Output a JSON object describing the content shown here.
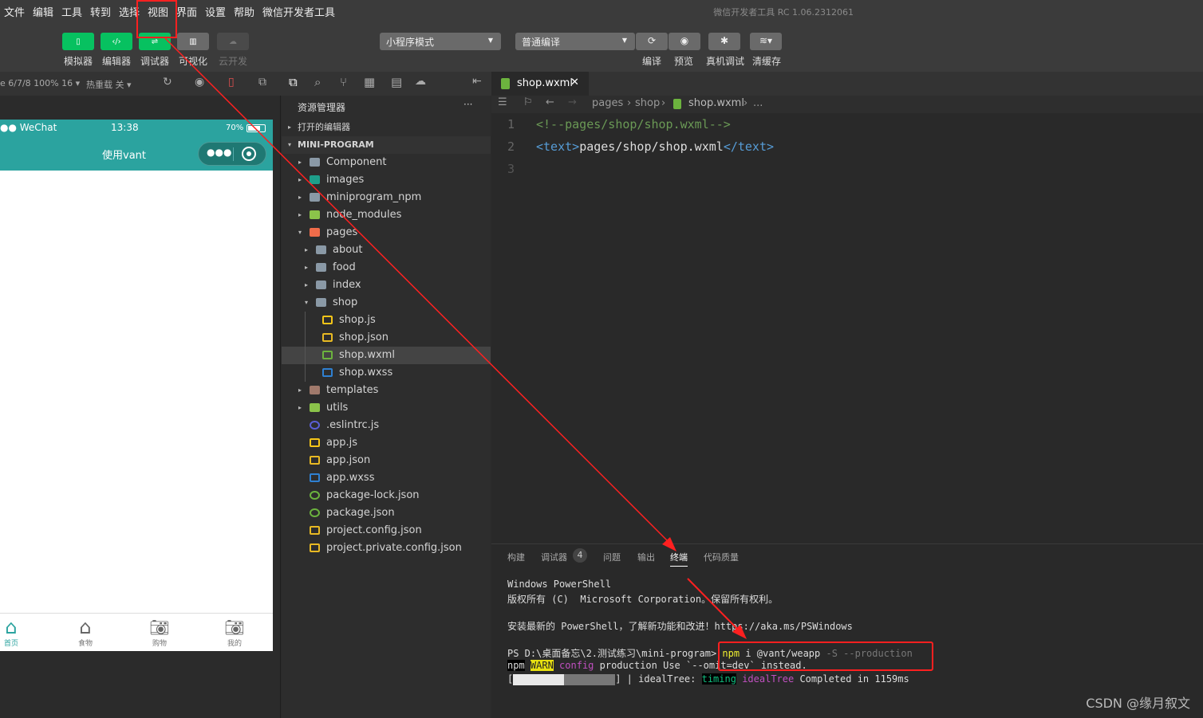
{
  "menu": [
    "文件",
    "编辑",
    "工具",
    "转到",
    "选择",
    "视图",
    "界面",
    "设置",
    "帮助",
    "微信开发者工具"
  ],
  "window_title": "微信开发者工具 RC 1.06.2312061",
  "toolbar": {
    "buttons": [
      {
        "label": "模拟器",
        "icon": "phone-icon"
      },
      {
        "label": "编辑器",
        "icon": "code-icon"
      },
      {
        "label": "调试器",
        "icon": "sliders-icon"
      },
      {
        "label": "可视化",
        "icon": "layout-icon"
      },
      {
        "label": "云开发",
        "icon": "cloud-icon"
      }
    ],
    "mode_select": "小程序模式",
    "compile_select": "普通编译",
    "actions": [
      "编译",
      "预览",
      "真机调试",
      "清缓存"
    ]
  },
  "subbar": {
    "device": "e 6/7/8 100% 16",
    "hot_reload": "热重载 关"
  },
  "phone": {
    "carrier": "●● WeChat",
    "time": "13:38",
    "battery": "70%",
    "title": "使用vant",
    "tabs": [
      {
        "label": "首页",
        "icon": "home-icon",
        "active": true
      },
      {
        "label": "食物",
        "icon": "home-icon"
      },
      {
        "label": "购物",
        "icon": "camera-icon"
      },
      {
        "label": "我的",
        "icon": "camera-icon"
      }
    ]
  },
  "explorer": {
    "title": "资源管理器",
    "more": "···",
    "open_editors": "打开的编辑器",
    "project": "MINI-PROGRAM",
    "items": [
      {
        "name": "Component",
        "level": 1,
        "type": "folder",
        "arrow": "▸",
        "color": "#8a99a6"
      },
      {
        "name": "images",
        "level": 1,
        "type": "folder",
        "arrow": "▸",
        "color": "#1e9e8a"
      },
      {
        "name": "miniprogram_npm",
        "level": 1,
        "type": "folder",
        "arrow": "▸",
        "color": "#8a99a6"
      },
      {
        "name": "node_modules",
        "level": 1,
        "type": "folder",
        "arrow": "▸",
        "color": "#8bc34a"
      },
      {
        "name": "pages",
        "level": 1,
        "type": "folder",
        "arrow": "▾",
        "color": "#f06c4a"
      },
      {
        "name": "about",
        "level": 2,
        "type": "folder",
        "arrow": "▸",
        "color": "#8a99a6"
      },
      {
        "name": "food",
        "level": 2,
        "type": "folder",
        "arrow": "▸",
        "color": "#8a99a6"
      },
      {
        "name": "index",
        "level": 2,
        "type": "folder",
        "arrow": "▸",
        "color": "#8a99a6"
      },
      {
        "name": "shop",
        "level": 2,
        "type": "folder",
        "arrow": "▾",
        "color": "#8a99a6"
      },
      {
        "name": "shop.js",
        "level": 3,
        "type": "js",
        "color": "#f5c518"
      },
      {
        "name": "shop.json",
        "level": 3,
        "type": "json",
        "color": "#e8b923"
      },
      {
        "name": "shop.wxml",
        "level": 3,
        "type": "wxml",
        "color": "#6cb33e",
        "selected": true
      },
      {
        "name": "shop.wxss",
        "level": 3,
        "type": "wxss",
        "color": "#2f80d1"
      },
      {
        "name": "templates",
        "level": 1,
        "type": "folder",
        "arrow": "▸",
        "color": "#a0796b"
      },
      {
        "name": "utils",
        "level": 1,
        "type": "folder",
        "arrow": "▸",
        "color": "#8bc34a"
      },
      {
        "name": ".eslintrc.js",
        "level": 1,
        "type": "eslint",
        "color": "#5a5fd6"
      },
      {
        "name": "app.js",
        "level": 1,
        "type": "js",
        "color": "#f5c518"
      },
      {
        "name": "app.json",
        "level": 1,
        "type": "json",
        "color": "#e8b923"
      },
      {
        "name": "app.wxss",
        "level": 1,
        "type": "wxss",
        "color": "#2f80d1"
      },
      {
        "name": "package-lock.json",
        "level": 1,
        "type": "npm",
        "color": "#6cb33e"
      },
      {
        "name": "package.json",
        "level": 1,
        "type": "npm",
        "color": "#6cb33e"
      },
      {
        "name": "project.config.json",
        "level": 1,
        "type": "json",
        "color": "#e8b923"
      },
      {
        "name": "project.private.config.json",
        "level": 1,
        "type": "json",
        "color": "#e8b923"
      }
    ]
  },
  "editor": {
    "tab": "shop.wxml",
    "close": "✕",
    "breadcrumb": [
      "pages",
      "shop",
      "shop.wxml",
      "..."
    ],
    "lines": [
      {
        "n": "1",
        "comment": "<!--pages/shop/shop.wxml-->"
      },
      {
        "n": "2",
        "open": "<text>",
        "text": "pages/shop/shop.wxml",
        "close": "</text>"
      },
      {
        "n": "3"
      }
    ]
  },
  "panel": {
    "tabs": [
      "构建",
      "调试器",
      "问题",
      "输出",
      "终端",
      "代码质量"
    ],
    "debugger_badge": "4",
    "active_tab": "终端",
    "terminal": {
      "l1": "Windows PowerShell",
      "l2": "版权所有 (C)  Microsoft Corporation。保留所有权利。",
      "l3": "安装最新的 PowerShell，了解新功能和改进！https://aka.ms/PSWindows",
      "prompt": "PS D:\\桌面备忘\\2.测试练习\\mini-program> ",
      "cmd": "npm",
      "args": " i @vant/weapp ",
      "flags": "-S --production",
      "w_npm": "npm",
      "w_warn": "WARN",
      "w_config": " config",
      "w_msg": " production Use `--omit=dev` instead.",
      "p_open": "[",
      "p_close": "] | idealTree: ",
      "p_timing": "timing",
      "p_ideal": " idealTree",
      "p_msg": " Completed in 1159ms"
    }
  },
  "watermark": "CSDN @缘月叙文",
  "colors": {
    "accent": "#07c160",
    "nav": "#2ba39f",
    "annotation": "#ff2020"
  }
}
